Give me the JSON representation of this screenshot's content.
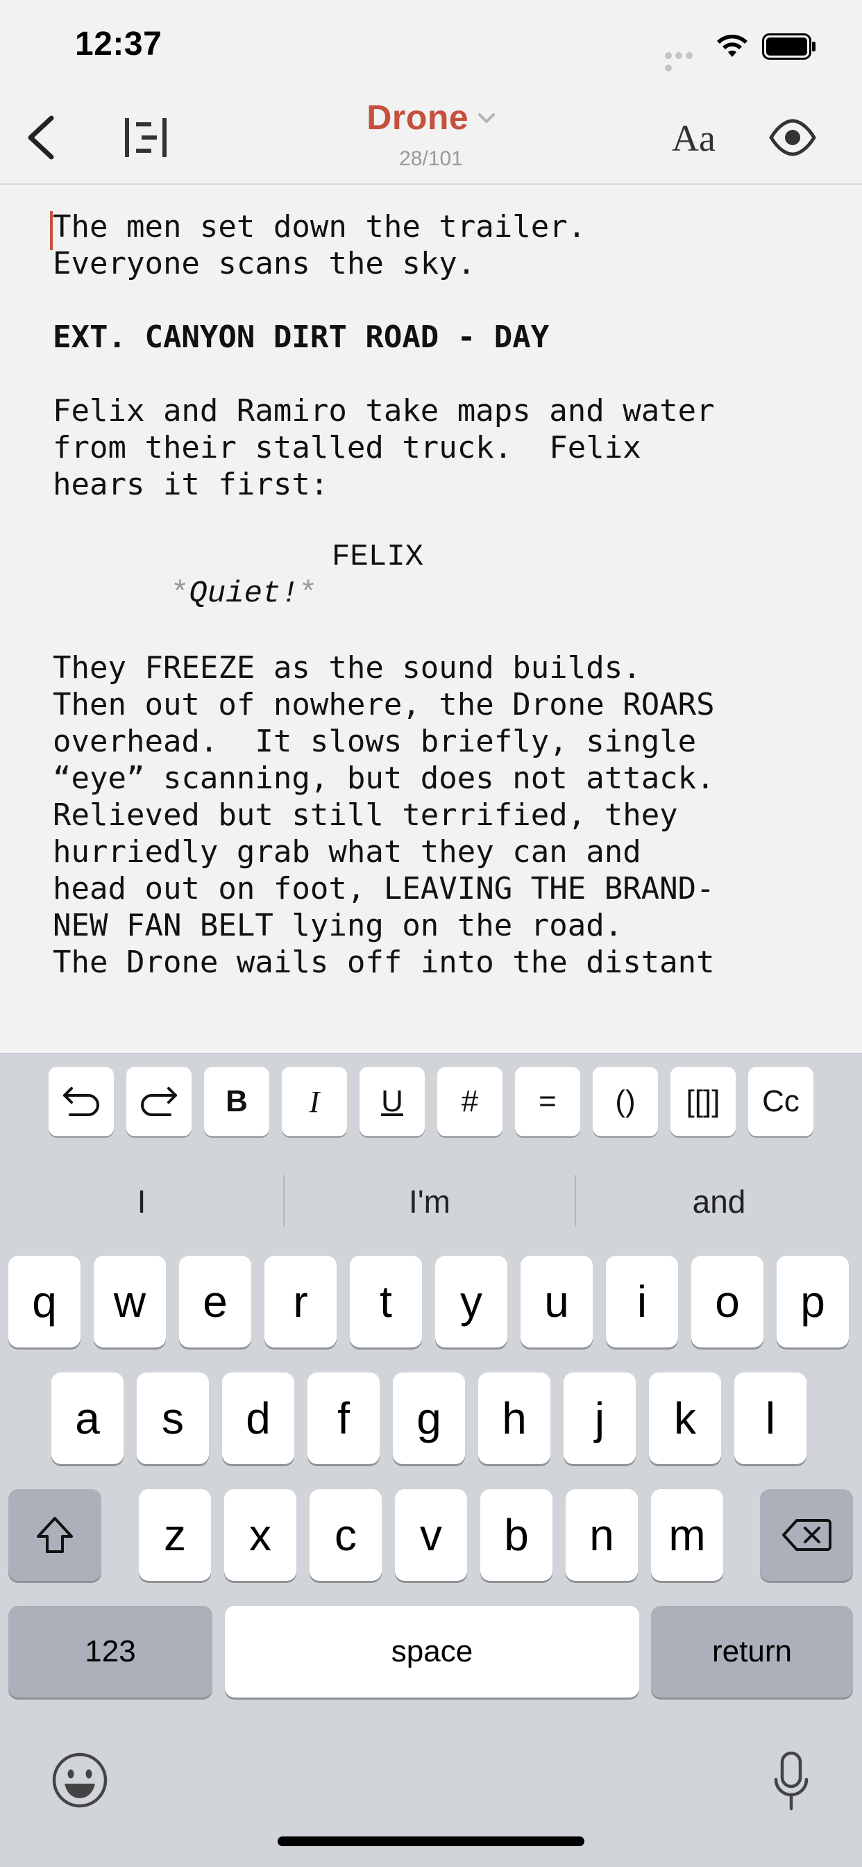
{
  "status": {
    "time": "12:37"
  },
  "nav": {
    "title": "Drone",
    "page_indicator": "28/101",
    "font_label": "Aa"
  },
  "script": {
    "action1": "The men set down the trailer.\nEveryone scans the sky.",
    "scene_heading": "EXT. CANYON DIRT ROAD - DAY",
    "action2": "Felix and Ramiro take maps and water\nfrom their stalled truck.  Felix\nhears it first:",
    "character": "FELIX",
    "dialogue_open": "*",
    "dialogue": "Quiet!",
    "dialogue_close": "*",
    "action3": "They FREEZE as the sound builds.\nThen out of nowhere, the Drone ROARS\noverhead.  It slows briefly, single\n“eye” scanning, but does not attack.",
    "action4": "Relieved but still terrified, they\nhurriedly grab what they can and\nhead out on foot, LEAVING THE BRAND-\nNEW FAN BELT lying on the road.",
    "action5": "The Drone wails off into the distant"
  },
  "toolbar": {
    "bold": "B",
    "italic": "I",
    "underline": "U",
    "hash": "#",
    "equals": "=",
    "parens": "()",
    "brackets": "[[]]",
    "case": "Cc"
  },
  "suggestions": [
    "I",
    "I'm",
    "and"
  ],
  "keyboard": {
    "row1": [
      "q",
      "w",
      "e",
      "r",
      "t",
      "y",
      "u",
      "i",
      "o",
      "p"
    ],
    "row2": [
      "a",
      "s",
      "d",
      "f",
      "g",
      "h",
      "j",
      "k",
      "l"
    ],
    "row3": [
      "z",
      "x",
      "c",
      "v",
      "b",
      "n",
      "m"
    ],
    "numbers": "123",
    "space": "space",
    "return": "return"
  }
}
